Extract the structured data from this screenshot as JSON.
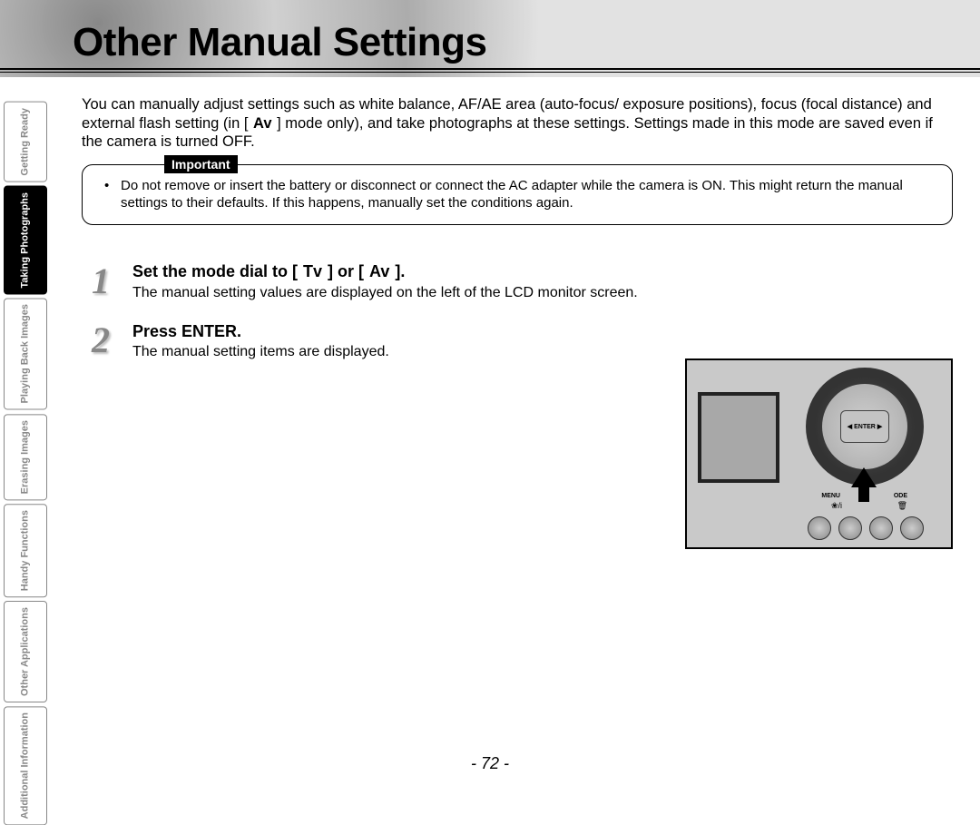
{
  "page": {
    "title": "Other Manual Settings",
    "number": "- 72 -"
  },
  "sidebar": {
    "tabs": [
      {
        "label": "Getting\nReady",
        "active": false
      },
      {
        "label": "Taking\nPhotographs",
        "active": true
      },
      {
        "label": "Playing\nBack Images",
        "active": false
      },
      {
        "label": "Erasing\nImages",
        "active": false
      },
      {
        "label": "Handy\nFunctions",
        "active": false
      },
      {
        "label": "Other\nApplications",
        "active": false
      },
      {
        "label": "Additional\nInformation",
        "active": false
      }
    ]
  },
  "intro": {
    "text_a": "You can manually adjust settings such as white balance, AF/AE area (auto-focus/ exposure positions), focus (focal distance) and external flash setting (in [ ",
    "mode_av": "Av",
    "text_b": " ] mode only), and take photographs at these settings. Settings made in this mode are saved even if the camera is turned OFF."
  },
  "important": {
    "label": "Important",
    "text": "Do not remove or insert the battery or disconnect or connect the AC adapter while the camera is ON. This might return the manual settings to their defaults. If this happens, manually set the conditions again."
  },
  "steps": [
    {
      "num": "1",
      "title_a": "Set the mode dial to [ ",
      "mode_tv": "Tv",
      "title_b": " ] or [ ",
      "mode_av": "Av",
      "title_c": " ].",
      "desc": "The manual setting values are displayed on the left of the LCD monitor screen."
    },
    {
      "num": "2",
      "title": "Press ENTER.",
      "desc": "The manual setting items are displayed."
    }
  ],
  "camera": {
    "enter": "ENTER",
    "menu": "MENU",
    "mode": "ODE",
    "flower_icon": "❀/i",
    "trash_icon": "🗑"
  }
}
